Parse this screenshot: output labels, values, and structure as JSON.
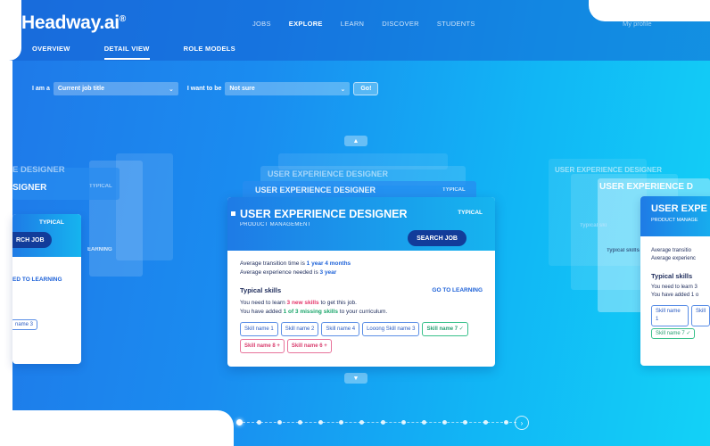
{
  "brand": {
    "logo": "Headway.ai",
    "logo_mark": "®"
  },
  "main_nav": [
    "JOBS",
    "EXPLORE",
    "LEARN",
    "DISCOVER",
    "STUDENTS"
  ],
  "main_nav_active": "EXPLORE",
  "profile_label": "My profile",
  "sub_nav": [
    "OVERVIEW",
    "DETAIL VIEW",
    "ROLE MODELS"
  ],
  "sub_nav_active": "DETAIL VIEW",
  "filter": {
    "i_am_label": "I am a",
    "current_job_placeholder": "Current job title",
    "want_label": "I want to be",
    "target_value": "Not sure",
    "go_label": "Go!"
  },
  "main_card": {
    "title": "USER EXPERIENCE DESIGNER",
    "subtitle": "PRODUCT MANAGEMENT",
    "badge": "TYPICAL",
    "search_button": "SEARCH JOB",
    "transition_prefix": "Average transition time is ",
    "transition_value": "1 year 4 months",
    "experience_prefix": "Average experience needed is ",
    "experience_value": "3 year",
    "skills_heading": "Typical skills",
    "goto_learning": "GO TO LEARNING",
    "learn_prefix": "You need to learn ",
    "learn_value": "3 new skills",
    "learn_suffix": " to get this job.",
    "added_prefix": "You have added ",
    "added_value": "1 of 3 missing skills",
    "added_suffix": " to your curriculum.",
    "chips": [
      {
        "label": "Skill name 1",
        "style": "blue"
      },
      {
        "label": "Skill name 2",
        "style": "blue"
      },
      {
        "label": "Skill name 4",
        "style": "blue"
      },
      {
        "label": "Looong Skill name 3",
        "style": "blue"
      },
      {
        "label": "Skill name 7  ✓",
        "style": "green"
      },
      {
        "label": "Skill name 8  +",
        "style": "pink"
      },
      {
        "label": "Skill name 6  +",
        "style": "pink"
      }
    ]
  },
  "ghost_titles": {
    "center_1": "USER EXPERIENCE DESIGNER",
    "center_badge": "TYPICAL",
    "left_title": "SIGNER",
    "left_ghost": "E DESIGNER",
    "left_typical": "TYPICAL",
    "right_title": "USER EXPERIENCE D",
    "right_ghost": "USER EXPERIENCE DESIGNER"
  },
  "left_card": {
    "badge": "TYPICAL",
    "search_button": "RCH JOB",
    "goto_learning": "ED TO LEARNING",
    "chip": "name 3",
    "ghost_learning": "EARNING"
  },
  "right_card": {
    "title": "USER EXPE",
    "subtitle": "PRODUCT MANAGE",
    "line1": "Average transitio",
    "line2": "Average experienc",
    "skills_heading": "Typical skills",
    "learn": "You need to learn 3",
    "added": "You have added 1 o",
    "chip1": "Skill name 1",
    "chip2": "Skill",
    "chip3": "Skill name 7 ✓",
    "ghost_skills": "Typical ski",
    "ghost_line": "Average tr"
  },
  "pager": {
    "count": 14,
    "active_index": 0
  }
}
